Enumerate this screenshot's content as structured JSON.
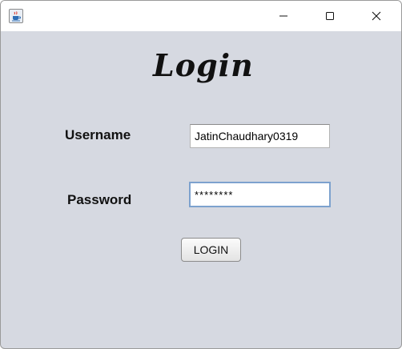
{
  "window": {
    "app_icon": "java-cup-icon",
    "controls": {
      "minimize_icon": "minimize-icon",
      "maximize_icon": "maximize-icon",
      "close_icon": "close-icon"
    }
  },
  "form": {
    "title": "Login",
    "username_label": "Username",
    "username_value": "JatinChaudhary0319",
    "password_label": "Password",
    "password_value": "********",
    "login_button": "LOGIN"
  },
  "colors": {
    "background": "#d6d9e1",
    "focus_border": "#7da2ce"
  }
}
